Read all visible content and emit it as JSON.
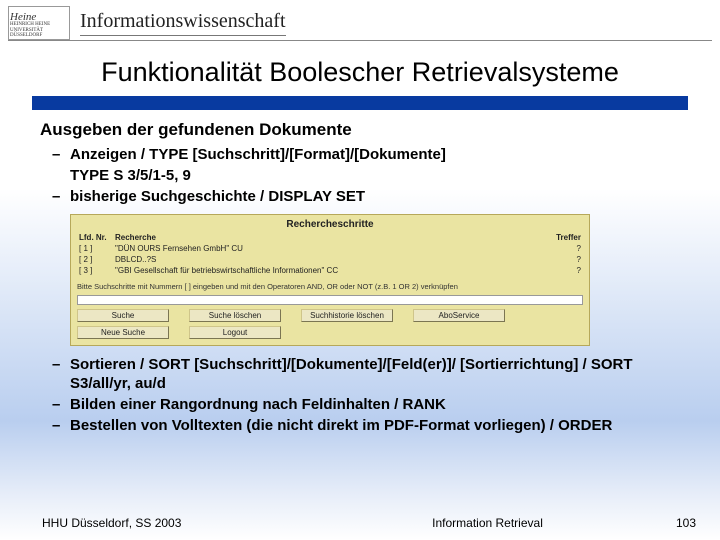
{
  "header": {
    "uni_logo_line1": "HEINRICH HEINE",
    "uni_logo_line2": "UNIVERSITÄT",
    "uni_logo_line3": "DÜSSELDORF",
    "department": "Informationswissenschaft"
  },
  "title": "Funktionalität Boolescher Retrievalsysteme",
  "section_heading": "Ausgeben der gefundenen Dokumente",
  "bullets_top": [
    "Anzeigen / TYPE [Suchschritt]/[Format]/[Dokumente]",
    "TYPE S 3/5/1-5, 9",
    "bisherige Suchgeschichte / DISPLAY SET"
  ],
  "mock": {
    "title": "Rechercheschritte",
    "columns": [
      "Lfd. Nr.",
      "Recherche",
      "Treffer"
    ],
    "rows": [
      {
        "n": "[ 1 ]",
        "q": "\"DÜN OURS Fernsehen GmbH\" CU",
        "t": "?"
      },
      {
        "n": "[ 2 ]",
        "q": "DBLCD..?S",
        "t": "?"
      },
      {
        "n": "[ 3 ]",
        "q": "\"GBI Gesellschaft für betriebswirtschaftliche Informationen\" CC",
        "t": "?"
      }
    ],
    "hint": "Bitte Suchschritte mit Nummern [ ] eingeben und mit den Operatoren AND, OR oder NOT (z.B. 1 OR 2) verknüpfen",
    "buttons_row1": [
      "Suche",
      "Suche löschen",
      "Suchhistorie löschen",
      "AboService"
    ],
    "buttons_row2": [
      "Neue Suche",
      "Logout"
    ]
  },
  "bullets_bottom": [
    "Sortieren / SORT [Suchschritt]/[Dokumente]/[Feld(er)]/ [Sortierrichtung]   /   SORT S3/all/yr, au/d",
    "Bilden einer Rangordnung nach Feldinhalten / RANK",
    "Bestellen von Volltexten (die nicht direkt im PDF-Format vorliegen) / ORDER"
  ],
  "footer": {
    "left": "HHU Düsseldorf, SS 2003",
    "center": "Information Retrieval",
    "right": "103"
  }
}
